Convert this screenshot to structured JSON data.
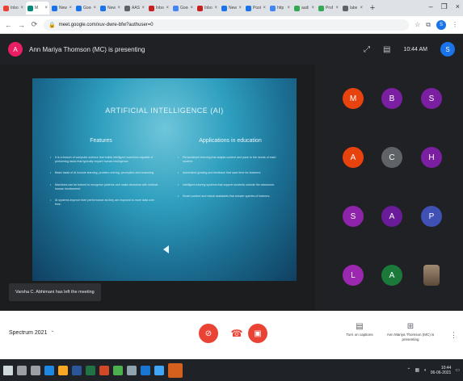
{
  "browser": {
    "tabs": [
      {
        "label": "Inbo",
        "color": "#ea4335",
        "active": false
      },
      {
        "label": "M",
        "color": "#00897b",
        "active": true
      },
      {
        "label": "New",
        "color": "#1a73e8",
        "active": false
      },
      {
        "label": "Goog",
        "color": "#1a73e8",
        "active": false
      },
      {
        "label": "New",
        "color": "#1a73e8",
        "active": false
      },
      {
        "label": "AAST",
        "color": "#5f6368",
        "active": false
      },
      {
        "label": "Inbo",
        "color": "#c5221f",
        "active": false
      },
      {
        "label": "Goog",
        "color": "#4285f4",
        "active": false
      },
      {
        "label": "Inbo",
        "color": "#c5221f",
        "active": false
      },
      {
        "label": "New",
        "color": "#1a73e8",
        "active": false
      },
      {
        "label": "Post",
        "color": "#1a73e8",
        "active": false
      },
      {
        "label": "http",
        "color": "#4285f4",
        "active": false
      },
      {
        "label": "audi",
        "color": "#34a853",
        "active": false
      },
      {
        "label": "Prof",
        "color": "#34a853",
        "active": false
      },
      {
        "label": "labe",
        "color": "#5f6368",
        "active": false
      }
    ],
    "new_tab": "+",
    "window_controls": {
      "minimize": "–",
      "maximize": "❐",
      "close": "×"
    },
    "url": "meet.google.com/xuv-dwre-bfw?authuser=0",
    "profile_initial": "S"
  },
  "meet": {
    "presenter_initial": "A",
    "presenting_text": "Ann Mariya Thomson (MC) is presenting",
    "clock": "10:44 AM",
    "self_initial": "S",
    "slide": {
      "title": "ARTIFICIAL INTELLIGENCE (AI)",
      "col1_title": "Features",
      "col1_items": [
        "It is a branch of computer science that builds intelligent machines capable of performing tasks that typically require human intelligence.",
        "Basic tasks of AI include learning, problem solving, perception and reasoning.",
        "Machines can be trained to recognise patterns and make decisions with minimal human involvement.",
        "AI systems improve their performance as they are exposed to more data over time."
      ],
      "col2_title": "Applications in education",
      "col2_items": [
        "Personalised learning that adapts content and pace to the needs of each student.",
        "Automated grading and feedback that save time for teachers.",
        "Intelligent tutoring systems that support students outside the classroom.",
        "Smart content and virtual assistants that answer queries of learners."
      ]
    },
    "notification": "Varsha C. Abhimani has left the meeting",
    "participants": [
      {
        "initial": "M",
        "color": "#e8430f"
      },
      {
        "initial": "B",
        "color": "#7b1fa2"
      },
      {
        "initial": "S",
        "color": "#7b1fa2"
      },
      {
        "initial": "A",
        "color": "#e8430f"
      },
      {
        "initial": "C",
        "color": "#5f6368"
      },
      {
        "initial": "H",
        "color": "#7b1fa2"
      },
      {
        "initial": "S",
        "color": "#8e24aa"
      },
      {
        "initial": "A",
        "color": "#6a1b9a"
      },
      {
        "initial": "P",
        "color": "#3f51b5"
      },
      {
        "initial": "L",
        "color": "#9c27b0"
      },
      {
        "initial": "A",
        "color": "#1b7a3a"
      },
      {
        "initial": "",
        "color": "#8d6e63"
      }
    ],
    "meeting_name": "Spectrum 2021",
    "captions_label": "Turn on captions",
    "presenting_label": "Ann Mariya Thomson (MC) is presenting",
    "accent_red": "#ea4335"
  },
  "taskbar": {
    "apps": [
      {
        "name": "windows",
        "color": "#cfd8dc"
      },
      {
        "name": "search",
        "color": "#9aa0a6"
      },
      {
        "name": "taskview",
        "color": "#9aa0a6"
      },
      {
        "name": "edge",
        "color": "#1e88e5"
      },
      {
        "name": "explorer",
        "color": "#f9a825"
      },
      {
        "name": "word",
        "color": "#2b579a"
      },
      {
        "name": "excel",
        "color": "#217346"
      },
      {
        "name": "powerpoint",
        "color": "#d24726"
      },
      {
        "name": "chrome",
        "color": "#4caf50"
      },
      {
        "name": "settings",
        "color": "#90a4ae"
      },
      {
        "name": "mail",
        "color": "#1976d2"
      },
      {
        "name": "store",
        "color": "#42a5f5"
      }
    ],
    "time": "10:44",
    "date": "06-06-2021"
  }
}
